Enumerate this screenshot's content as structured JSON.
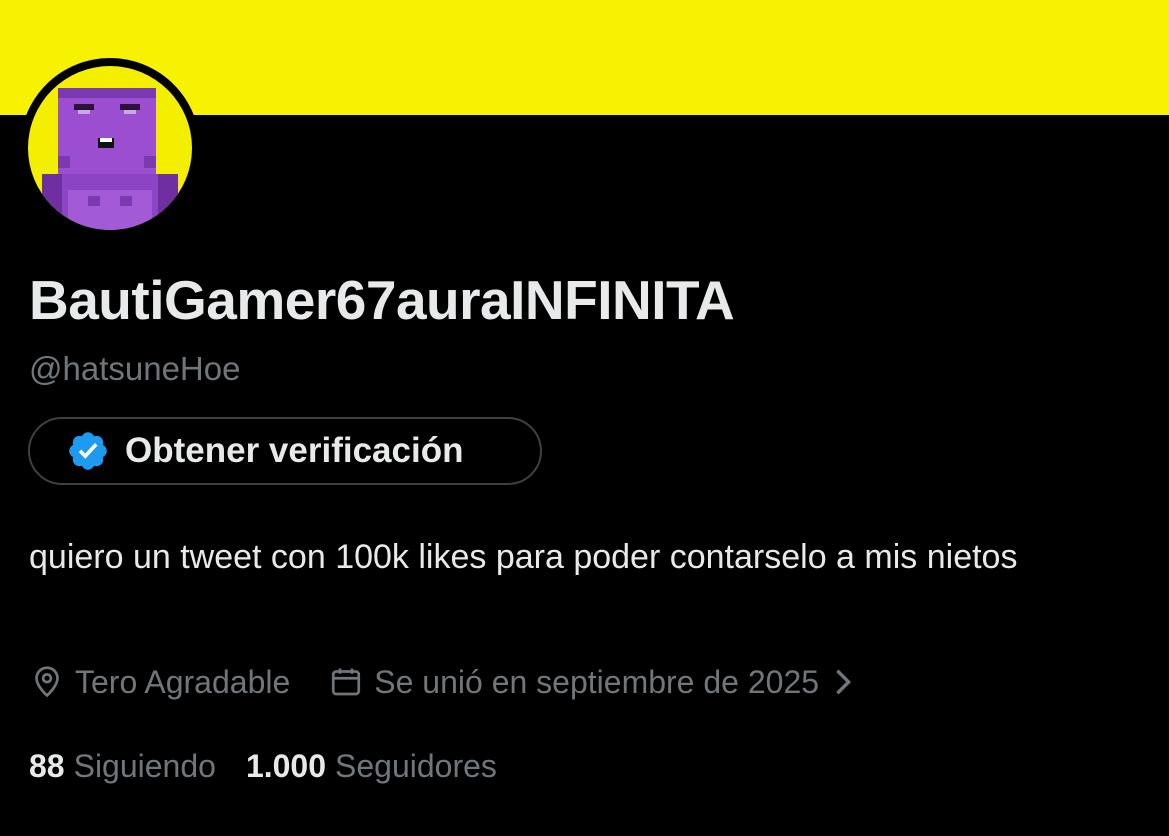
{
  "colors": {
    "banner": "#f6f200",
    "background": "#000000",
    "text_primary": "#e7e9ea",
    "text_secondary": "#71767b",
    "verified_blue": "#1d9bf0",
    "avatar_bg": "#f4ef00",
    "avatar_character": "#9b4fd0"
  },
  "profile": {
    "display_name": "BautiGamer67auraINFINITA",
    "handle": "@hatsuneHoe",
    "verify_button_label": "Obtener verificación",
    "bio": "quiero un tweet con 100k likes para poder contarselo a mis nietos",
    "location": "Tero Agradable",
    "joined": "Se unió en septiembre de 2025",
    "following_count": "88",
    "following_label": "Siguiendo",
    "followers_count": "1.000",
    "followers_label": "Seguidores"
  },
  "icons": {
    "verified": "verified-badge-icon",
    "location": "location-pin-icon",
    "calendar": "calendar-icon",
    "chevron": "chevron-right-icon"
  }
}
